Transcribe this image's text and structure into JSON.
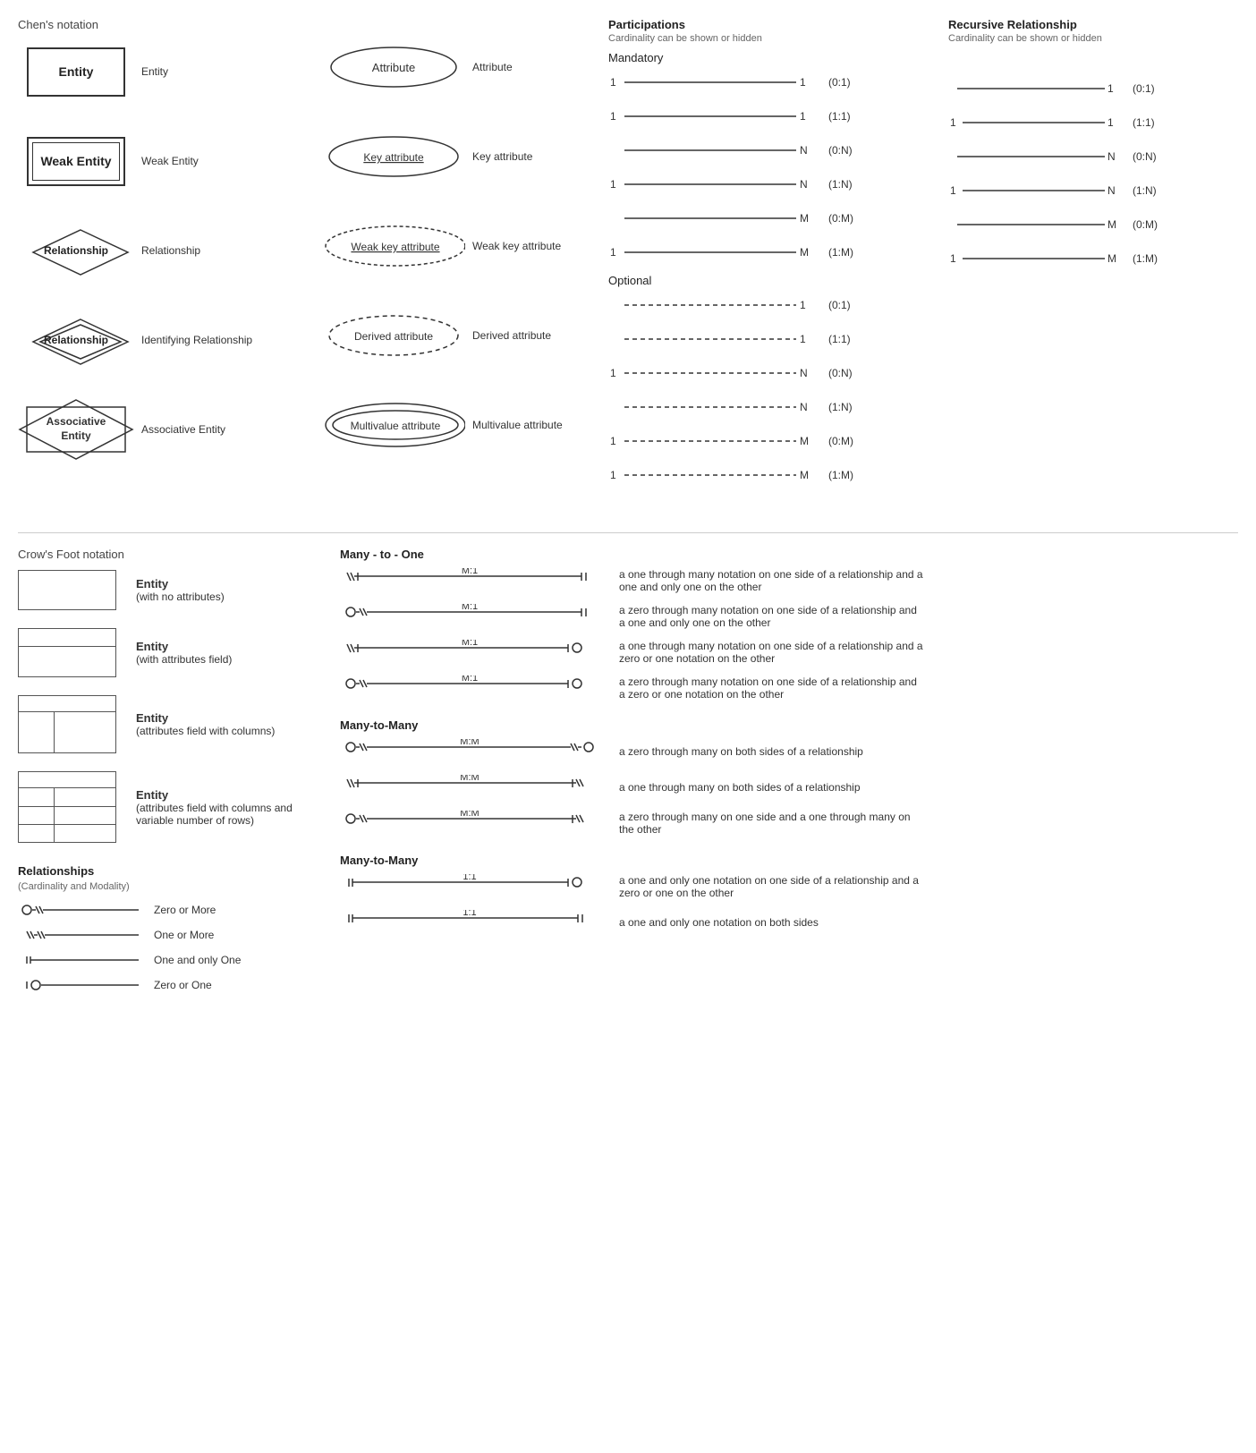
{
  "chens": {
    "title": "Chen's notation",
    "items": [
      {
        "shape": "entity",
        "label": "Entity",
        "text": "Entity"
      },
      {
        "shape": "weak-entity",
        "label": "Weak Entity",
        "text": "Weak Entity"
      },
      {
        "shape": "relationship",
        "label": "Relationship",
        "text": "Relationship"
      },
      {
        "shape": "identifying-relationship",
        "label": "Identifying Relationship",
        "text": "Relationship"
      },
      {
        "shape": "associative",
        "label": "Associative Entity",
        "text": "Associative\nEntity"
      }
    ]
  },
  "attributes": {
    "items": [
      {
        "shape": "ellipse",
        "label": "Attribute",
        "text": "Attribute"
      },
      {
        "shape": "key-ellipse",
        "label": "Key attribute",
        "text": "Key attribute"
      },
      {
        "shape": "weak-key-ellipse",
        "label": "Weak key attribute",
        "text": "Weak key attribute"
      },
      {
        "shape": "derived-ellipse",
        "label": "Derived attribute",
        "text": "Derived attribute"
      },
      {
        "shape": "multi-ellipse",
        "label": "Multivalue attribute",
        "text": "Multivalue attribute"
      }
    ]
  },
  "participations": {
    "title": "Participations",
    "subtitle": "Cardinality can be shown or hidden",
    "mandatory_label": "Mandatory",
    "optional_label": "Optional",
    "mandatory_rows": [
      {
        "left": "1",
        "right": "1",
        "notation": "(0:1)"
      },
      {
        "left": "1",
        "right": "1",
        "notation": "(1:1)"
      },
      {
        "left": "",
        "right": "N",
        "notation": "(0:N)"
      },
      {
        "left": "1",
        "right": "N",
        "notation": "(1:N)"
      },
      {
        "left": "",
        "right": "M",
        "notation": "(0:M)"
      },
      {
        "left": "1",
        "right": "M",
        "notation": "(1:M)"
      }
    ],
    "optional_rows": [
      {
        "left": "",
        "right": "1",
        "notation": "(0:1)",
        "dashed": true
      },
      {
        "left": "",
        "right": "1",
        "notation": "(1:1)",
        "dashed": true
      },
      {
        "left": "1",
        "right": "N",
        "notation": "(0:N)",
        "dashed": true
      },
      {
        "left": "",
        "right": "N",
        "notation": "(1:N)",
        "dashed": true
      },
      {
        "left": "1",
        "right": "M",
        "notation": "(0:M)",
        "dashed": true
      },
      {
        "left": "1",
        "right": "M",
        "notation": "(1:M)",
        "dashed": true
      }
    ]
  },
  "recursive": {
    "title": "Recursive Relationship",
    "subtitle": "Cardinality can be shown or hidden",
    "rows": [
      {
        "right": "1",
        "notation": "(0:1)"
      },
      {
        "left": "1",
        "right": "1",
        "notation": "(1:1)"
      },
      {
        "right": "N",
        "notation": "(0:N)"
      },
      {
        "left": "1",
        "right": "N",
        "notation": "(1:N)"
      },
      {
        "right": "M",
        "notation": "(0:M)"
      },
      {
        "left": "1",
        "right": "M",
        "notation": "(1:M)"
      }
    ]
  },
  "crows": {
    "title": "Crow's Foot notation",
    "entities": [
      {
        "label": "Entity",
        "sublabel": "(with no attributes)"
      },
      {
        "label": "Entity",
        "sublabel": "(with attributes field)"
      },
      {
        "label": "Entity",
        "sublabel": "(attributes field with columns)"
      },
      {
        "label": "Entity",
        "sublabel": "(attributes field with columns and\nvariable number of rows)"
      }
    ],
    "relationships_label": "Relationships",
    "relationships_sub": "(Cardinality and Modality)",
    "rel_symbols": [
      {
        "label": "Zero or More"
      },
      {
        "label": "One or More"
      },
      {
        "label": "One and only One"
      },
      {
        "label": "Zero or One"
      }
    ],
    "many_to_one_title": "Many - to - One",
    "many_to_one_rows": [
      {
        "ratio": "M:1",
        "desc": "a one through many notation on one side of a relationship and a one and only one on the other"
      },
      {
        "ratio": "M:1",
        "desc": "a zero through many notation on one side of a relationship and a one and only one on the other"
      },
      {
        "ratio": "M:1",
        "desc": "a one through many notation on one side of a relationship and a zero or one notation on the other"
      },
      {
        "ratio": "M:1",
        "desc": "a zero through many notation on one side of a relationship and a zero or one notation on the other"
      }
    ],
    "many_to_many_title": "Many-to-Many",
    "many_to_many_rows": [
      {
        "ratio": "M:M",
        "desc": "a zero through many on both sides of a relationship"
      },
      {
        "ratio": "M:M",
        "desc": "a one through many on both sides of a relationship"
      },
      {
        "ratio": "M:M",
        "desc": "a zero through many on one side and a one through many on the other"
      }
    ],
    "one_to_one_title": "Many-to-Many",
    "one_to_one_rows": [
      {
        "ratio": "1:1",
        "desc": "a one and only one notation on one side of a relationship and a zero or one on the other"
      },
      {
        "ratio": "1:1",
        "desc": "a one and only one notation on both sides"
      }
    ]
  }
}
